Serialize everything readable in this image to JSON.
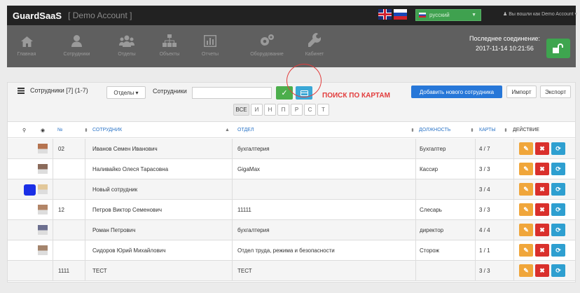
{
  "topbar": {
    "brand": "GuardSaaS",
    "account": "[ Demo Account ]",
    "language": "русский",
    "user_text": "♟ Вы вошли как Demo Account ▾"
  },
  "nav": {
    "items": [
      {
        "label": "Главная",
        "icon": "home-icon"
      },
      {
        "label": "Сотрудники",
        "icon": "user-icon"
      },
      {
        "label": "Отделы",
        "icon": "group-icon"
      },
      {
        "label": "Объекты",
        "icon": "sitemap-icon"
      },
      {
        "label": "Отчеты",
        "icon": "chart-icon"
      },
      {
        "label": "Оборудование",
        "icon": "gears-icon"
      },
      {
        "label": "Кабинет",
        "icon": "wrench-icon"
      }
    ],
    "last_connection_label": "Последнее соединение:",
    "last_connection_value": "2017-11-14 10:21:56"
  },
  "panel": {
    "title": "Сотрудники [7] (1-7)",
    "departments_button": "Отделы ▾",
    "employees_label": "Сотрудники",
    "search_value": "",
    "search_button": "✓",
    "card_search_hint": "ПОИСК ПО КАРТАМ",
    "add_button": "Добавить нового сотрудника",
    "import_button": "Импорт",
    "export_button": "Экспорт",
    "alphabet": [
      "ВСЕ",
      "И",
      "Н",
      "П",
      "Р",
      "С",
      "Т"
    ],
    "alphabet_active": "ВСЕ"
  },
  "table": {
    "headers": {
      "marker": "⚲",
      "photo": "◉",
      "number": "№",
      "employee": "СОТРУДНИК",
      "department": "ОТДЕЛ",
      "position": "ДОЛЖНОСТЬ",
      "cards": "КАРТЫ",
      "actions": "ДЕЙСТВИЕ"
    },
    "rows": [
      {
        "num": "02",
        "name": "Иванов Семен Иванович",
        "dept": "бухгалтерия",
        "position": "Бухгалтер",
        "cards": "4 / 7",
        "photo_color": "#b5734f",
        "marker": false
      },
      {
        "num": "",
        "name": "Наливайко Олеся Тарасовна",
        "dept": "GigaMax",
        "position": "Кассир",
        "cards": "3 / 3",
        "photo_color": "#8a6a5a",
        "marker": false
      },
      {
        "num": "",
        "name": "Новый сотрудник",
        "dept": "",
        "position": "",
        "cards": "3 / 4",
        "photo_color": "#e2c89a",
        "marker": true
      },
      {
        "num": "12",
        "name": "Петров Виктор Семенович",
        "dept": "11111",
        "position": "Слесарь",
        "cards": "3 / 3",
        "photo_color": "#b28567",
        "marker": false
      },
      {
        "num": "",
        "name": "Роман Петрович",
        "dept": "бухгалтерия",
        "position": "директор",
        "cards": "4 / 4",
        "photo_color": "#6c6f8f",
        "marker": false
      },
      {
        "num": "",
        "name": "Сидоров Юрий Михайлович",
        "dept": "Отдел труда, режима и безопасности",
        "position": "Сторож",
        "cards": "1 / 1",
        "photo_color": "#a4846c",
        "marker": false
      },
      {
        "num": "1111",
        "name": "ТЕСТ",
        "dept": "ТЕСТ",
        "position": "",
        "cards": "3 / 3",
        "photo_color": "",
        "marker": false
      }
    ],
    "action_icons": {
      "edit": "✎",
      "delete": "✖",
      "refresh": "⟳"
    }
  }
}
